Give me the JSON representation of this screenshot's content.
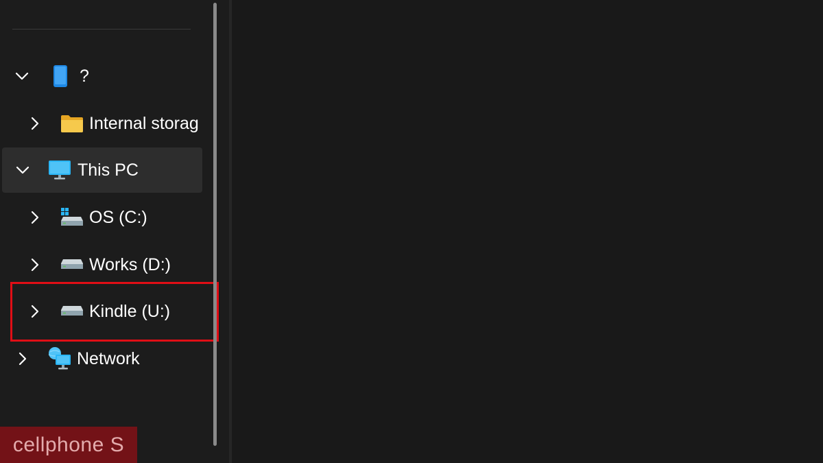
{
  "nav": {
    "items": [
      {
        "label": "?",
        "expanded": true,
        "icon": "phone-icon",
        "selected": false
      },
      {
        "label": "Internal storag",
        "expanded": false,
        "icon": "folder-icon",
        "selected": false
      },
      {
        "label": "This PC",
        "expanded": true,
        "icon": "monitor-icon",
        "selected": true
      },
      {
        "label": "OS (C:)",
        "expanded": false,
        "icon": "system-drive-icon",
        "selected": false
      },
      {
        "label": "Works (D:)",
        "expanded": false,
        "icon": "drive-icon",
        "selected": false
      },
      {
        "label": "Kindle (U:)",
        "expanded": false,
        "icon": "drive-icon",
        "selected": false,
        "highlighted": true
      },
      {
        "label": "Network",
        "expanded": false,
        "icon": "network-icon",
        "selected": false
      }
    ]
  },
  "watermark": {
    "text": "cellphone S"
  },
  "colors": {
    "background": "#1c1c1c",
    "selected_row": "#2d2d2d",
    "highlight_border": "#e00e16",
    "folder_yellow": "#f6c94c",
    "monitor_blue": "#29b6f6"
  }
}
